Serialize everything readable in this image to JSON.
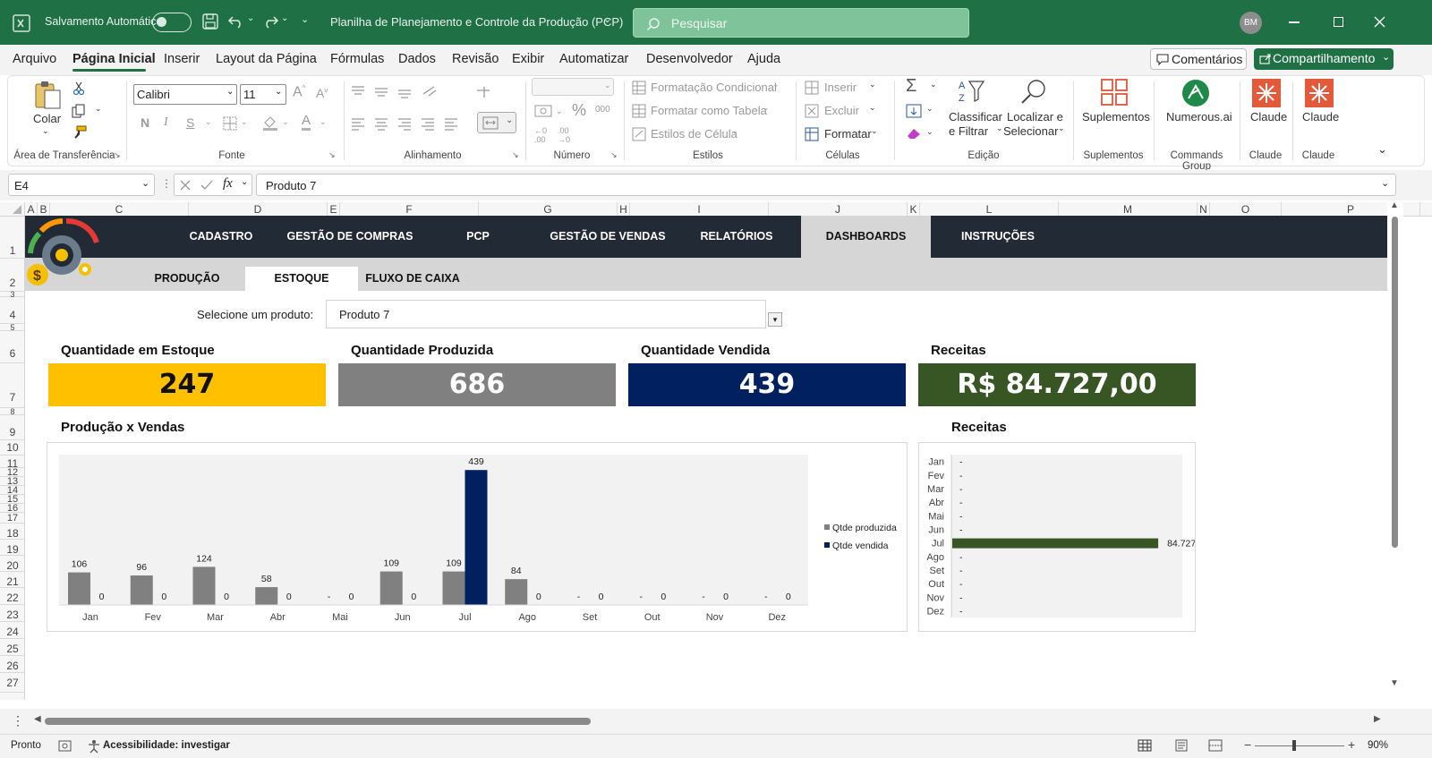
{
  "titlebar": {
    "autosave_label": "Salvamento Automático",
    "doc_title": "Planilha de Planejamento e Controle da Produção (PCP)",
    "search_placeholder": "Pesquisar",
    "user_initials": "BM"
  },
  "menu": {
    "tabs": [
      "Arquivo",
      "Página Inicial",
      "Inserir",
      "Layout da Página",
      "Fórmulas",
      "Dados",
      "Revisão",
      "Exibir",
      "Automatizar",
      "Desenvolvedor",
      "Ajuda"
    ],
    "active_tab": "Página Inicial",
    "comments_label": "Comentários",
    "share_label": "Compartilhamento"
  },
  "ribbon": {
    "clipboard": {
      "paste": "Colar",
      "group": "Área de Transferência"
    },
    "font": {
      "family": "Calibri",
      "size": "11",
      "group": "Fonte"
    },
    "alignment": {
      "group": "Alinhamento"
    },
    "number": {
      "group": "Número"
    },
    "styles": {
      "conditional": "Formatação Condicional",
      "table": "Formatar como Tabela",
      "cell_styles": "Estilos de Célula",
      "group": "Estilos"
    },
    "cells": {
      "insert": "Inserir",
      "delete": "Excluir",
      "format": "Formatar",
      "group": "Células"
    },
    "editing": {
      "sort_line1": "Classificar",
      "sort_line2": "e Filtrar",
      "find_line1": "Localizar e",
      "find_line2": "Selecionar",
      "group": "Edição"
    },
    "addins": {
      "label": "Suplementos",
      "group": "Suplementos"
    },
    "numerous": {
      "label": "Numerous.ai",
      "group": "Commands Group"
    },
    "claude1": {
      "label": "Claude",
      "group": "Claude"
    },
    "claude2": {
      "label": "Claude",
      "group": "Claude"
    }
  },
  "formula_bar": {
    "name_box": "E4",
    "fx": "fx",
    "content": "Produto 7"
  },
  "sheet": {
    "columns": [
      "A",
      "B",
      "C",
      "D",
      "E",
      "F",
      "G",
      "H",
      "I",
      "J",
      "K",
      "L",
      "M",
      "N",
      "O",
      "P"
    ],
    "rows": [
      "1",
      "2",
      "3",
      "4",
      "5",
      "6",
      "7",
      "8",
      "9",
      "10",
      "11",
      "12",
      "13",
      "14",
      "15",
      "16",
      "17",
      "18",
      "19",
      "20",
      "21",
      "22",
      "23",
      "24",
      "25",
      "26",
      "27"
    ]
  },
  "nav": {
    "tabs": [
      "CADASTRO",
      "GESTÃO DE COMPRAS",
      "PCP",
      "GESTÃO DE VENDAS",
      "RELATÓRIOS",
      "DASHBOARDS",
      "INSTRUÇÕES"
    ],
    "active": "DASHBOARDS",
    "subtabs": [
      "PRODUÇÃO",
      "ESTOQUE",
      "FLUXO DE CAIXA"
    ],
    "active_subtab": "ESTOQUE"
  },
  "selector": {
    "label": "Selecione um produto:",
    "value": "Produto 7"
  },
  "kpis": {
    "stock_title": "Quantidade em Estoque",
    "stock_value": "247",
    "produced_title": "Quantidade Produzida",
    "produced_value": "686",
    "sold_title": "Quantidade Vendida",
    "sold_value": "439",
    "revenue_title": "Receitas",
    "revenue_value": "R$ 84.727,00"
  },
  "colors": {
    "excel_green": "#1f7145",
    "nav_dark": "#222a35",
    "stock": "#ffc000",
    "produced": "#808080",
    "sold": "#002060",
    "revenue": "#375623"
  },
  "chart_data": [
    {
      "type": "bar",
      "title": "Produção x Vendas",
      "categories": [
        "Jan",
        "Fev",
        "Mar",
        "Abr",
        "Mai",
        "Jun",
        "Jul",
        "Ago",
        "Set",
        "Out",
        "Nov",
        "Dez"
      ],
      "series": [
        {
          "name": "Qtde produzida",
          "values": [
            106,
            96,
            124,
            58,
            0,
            109,
            109,
            84,
            0,
            0,
            0,
            0
          ],
          "labels": [
            "106",
            "96",
            "124",
            "58",
            "-",
            "109",
            "109",
            "84",
            "-",
            "-",
            "-",
            "-"
          ],
          "color": "#808080"
        },
        {
          "name": "Qtde vendida",
          "values": [
            0,
            0,
            0,
            0,
            0,
            0,
            439,
            0,
            0,
            0,
            0,
            0
          ],
          "labels": [
            "0",
            "0",
            "0",
            "0",
            "0",
            "0",
            "439",
            "0",
            "0",
            "0",
            "0",
            "0"
          ],
          "color": "#002060"
        }
      ],
      "ylim": [
        0,
        460
      ],
      "legend": "right",
      "grid": false
    },
    {
      "type": "bar",
      "orientation": "horizontal",
      "title": "Receitas",
      "categories": [
        "Jan",
        "Fev",
        "Mar",
        "Abr",
        "Mai",
        "Jun",
        "Jul",
        "Ago",
        "Set",
        "Out",
        "Nov",
        "Dez"
      ],
      "values": [
        0,
        0,
        0,
        0,
        0,
        0,
        84727,
        0,
        0,
        0,
        0,
        0
      ],
      "labels": [
        "-",
        "-",
        "-",
        "-",
        "-",
        "-",
        "84.727",
        "-",
        "-",
        "-",
        "-",
        "-"
      ],
      "xlim": [
        0,
        95000
      ],
      "color": "#375623",
      "grid": false
    }
  ],
  "status": {
    "ready": "Pronto",
    "accessibility": "Acessibilidade: investigar",
    "zoom": "90%"
  }
}
